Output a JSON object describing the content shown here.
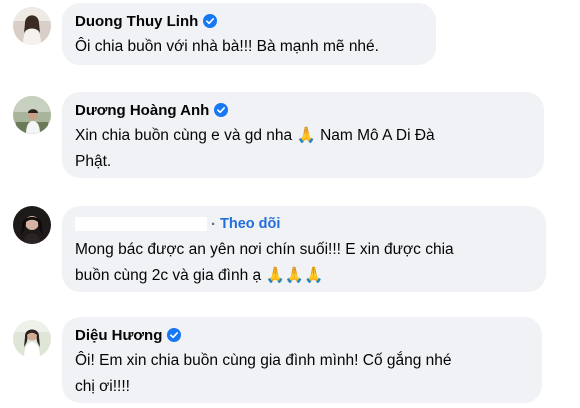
{
  "comments": [
    {
      "author": "Duong Thuy Linh",
      "verified": true,
      "text": "Ôi chia buồn với nhà bà!!! Bà mạnh mẽ nhé."
    },
    {
      "author": "Dương Hoàng Anh",
      "verified": true,
      "text": "Xin chia buồn cùng e và gd nha 🙏 Nam Mô A Di Đà\nPhật."
    },
    {
      "author": "",
      "verified": false,
      "follow_separator": "·",
      "follow_label": "Theo dõi",
      "text": "Mong bác được an yên nơi chín suối!!! E xin được chia\nbuồn cùng 2c và gia đình ạ 🙏🙏🙏"
    },
    {
      "author": "Diệu Hương",
      "verified": true,
      "text": "Ôi! Em xin chia buồn cùng gia đình mình! Cố gắng nhé\nchị ơi!!!!"
    }
  ],
  "colors": {
    "bubble": "#f0f2f5",
    "verified_badge": "#1877f2",
    "follow_link": "#216fdb"
  },
  "icons": {
    "verified": "verified-badge-icon",
    "pray": "folded-hands-emoji"
  }
}
